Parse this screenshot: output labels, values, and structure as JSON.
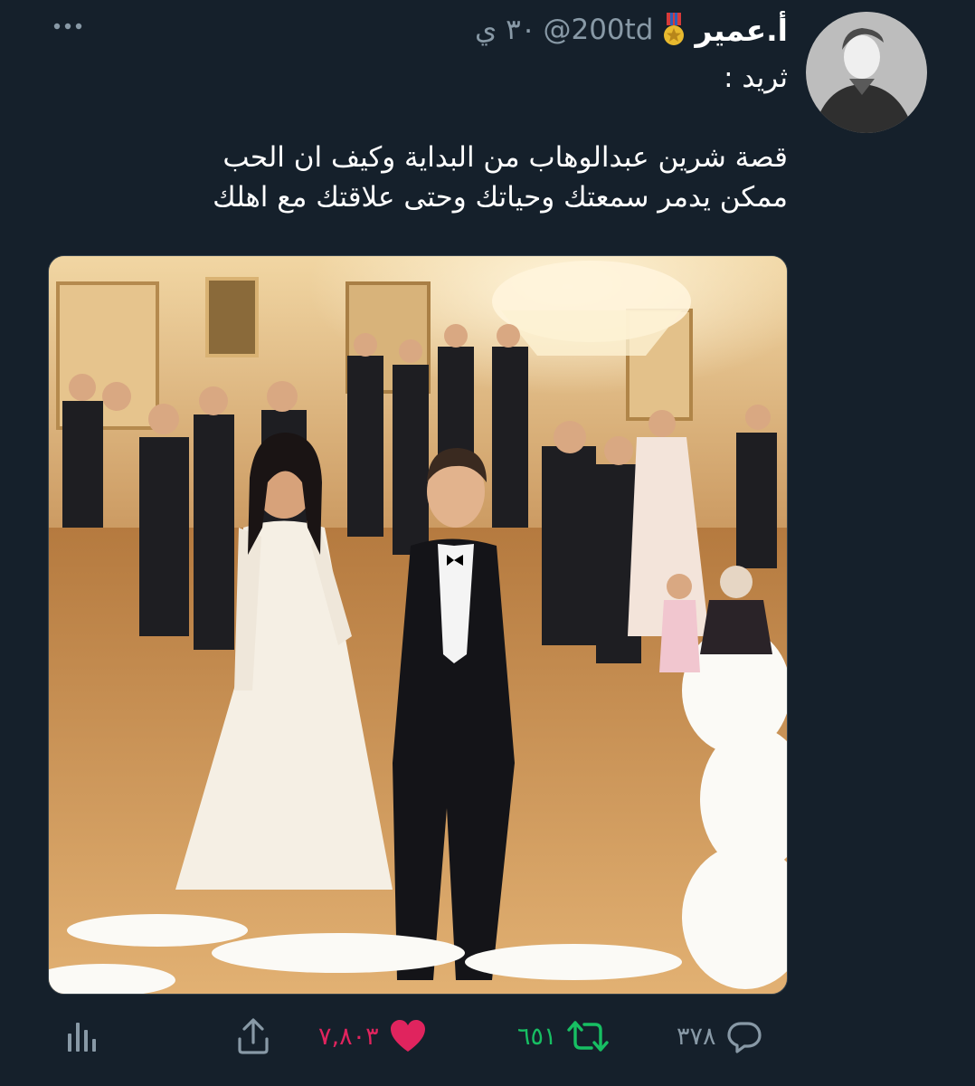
{
  "tweet": {
    "display_name": "أ.عمير",
    "badge_icon": "medal-icon",
    "handle": "@200td",
    "timestamp": "٣٠ ي",
    "more_icon": "more-icon",
    "text_lines": [
      "ثريد :",
      "",
      "قصة شرين عبدالوهاب من البداية وكيف ان الحب",
      "ممكن يدمر سمعتك وحياتك وحتى علاقتك مع اهلك"
    ]
  },
  "actions": {
    "reply": {
      "icon": "reply-icon",
      "count": "٣٧٨"
    },
    "retweet": {
      "icon": "retweet-icon",
      "count": "٦٥١"
    },
    "like": {
      "icon": "heart-icon",
      "count": "٧,٨٠٣"
    },
    "share": {
      "icon": "share-icon"
    },
    "analytics": {
      "icon": "analytics-icon"
    }
  },
  "colors": {
    "background": "#15202b",
    "secondary_text": "#8899a6",
    "retweet_green": "#17bf63",
    "like_pink": "#e0245e",
    "icon_gray": "#8899a6"
  }
}
